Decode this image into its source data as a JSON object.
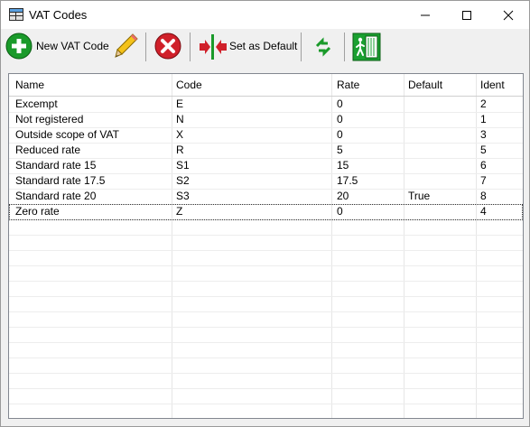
{
  "window": {
    "title": "VAT Codes",
    "icon": "database-table-icon",
    "controls": [
      "minimize-icon",
      "maximize-icon",
      "close-icon"
    ]
  },
  "toolbar": {
    "new_label": "New VAT Code",
    "edit_icon": "pencil-icon",
    "delete_icon": "red-x-icon",
    "set_default_label": "Set as Default",
    "refresh_icon": "refresh-arrows-icon",
    "exit_icon": "exit-door-icon"
  },
  "table": {
    "columns": [
      "Name",
      "Code",
      "Rate",
      "Default",
      "Ident"
    ],
    "rows": [
      {
        "name": "Excempt",
        "code": "E",
        "rate": "0",
        "default": "",
        "ident": "2"
      },
      {
        "name": "Not registered",
        "code": "N",
        "rate": "0",
        "default": "",
        "ident": "1"
      },
      {
        "name": "Outside scope of VAT",
        "code": "X",
        "rate": "0",
        "default": "",
        "ident": "3"
      },
      {
        "name": "Reduced rate",
        "code": "R",
        "rate": "5",
        "default": "",
        "ident": "5"
      },
      {
        "name": "Standard rate 15",
        "code": "S1",
        "rate": "15",
        "default": "",
        "ident": "6"
      },
      {
        "name": "Standard rate 17.5",
        "code": "S2",
        "rate": "17.5",
        "default": "",
        "ident": "7"
      },
      {
        "name": "Standard rate 20",
        "code": "S3",
        "rate": "20",
        "default": "True",
        "ident": "8"
      },
      {
        "name": "Zero rate",
        "code": "Z",
        "rate": "0",
        "default": "",
        "ident": "4"
      }
    ],
    "selected_ident": "4"
  },
  "colors": {
    "green": "#1a9a2a",
    "red": "#d0202a",
    "accent": "#0a7a1a"
  }
}
